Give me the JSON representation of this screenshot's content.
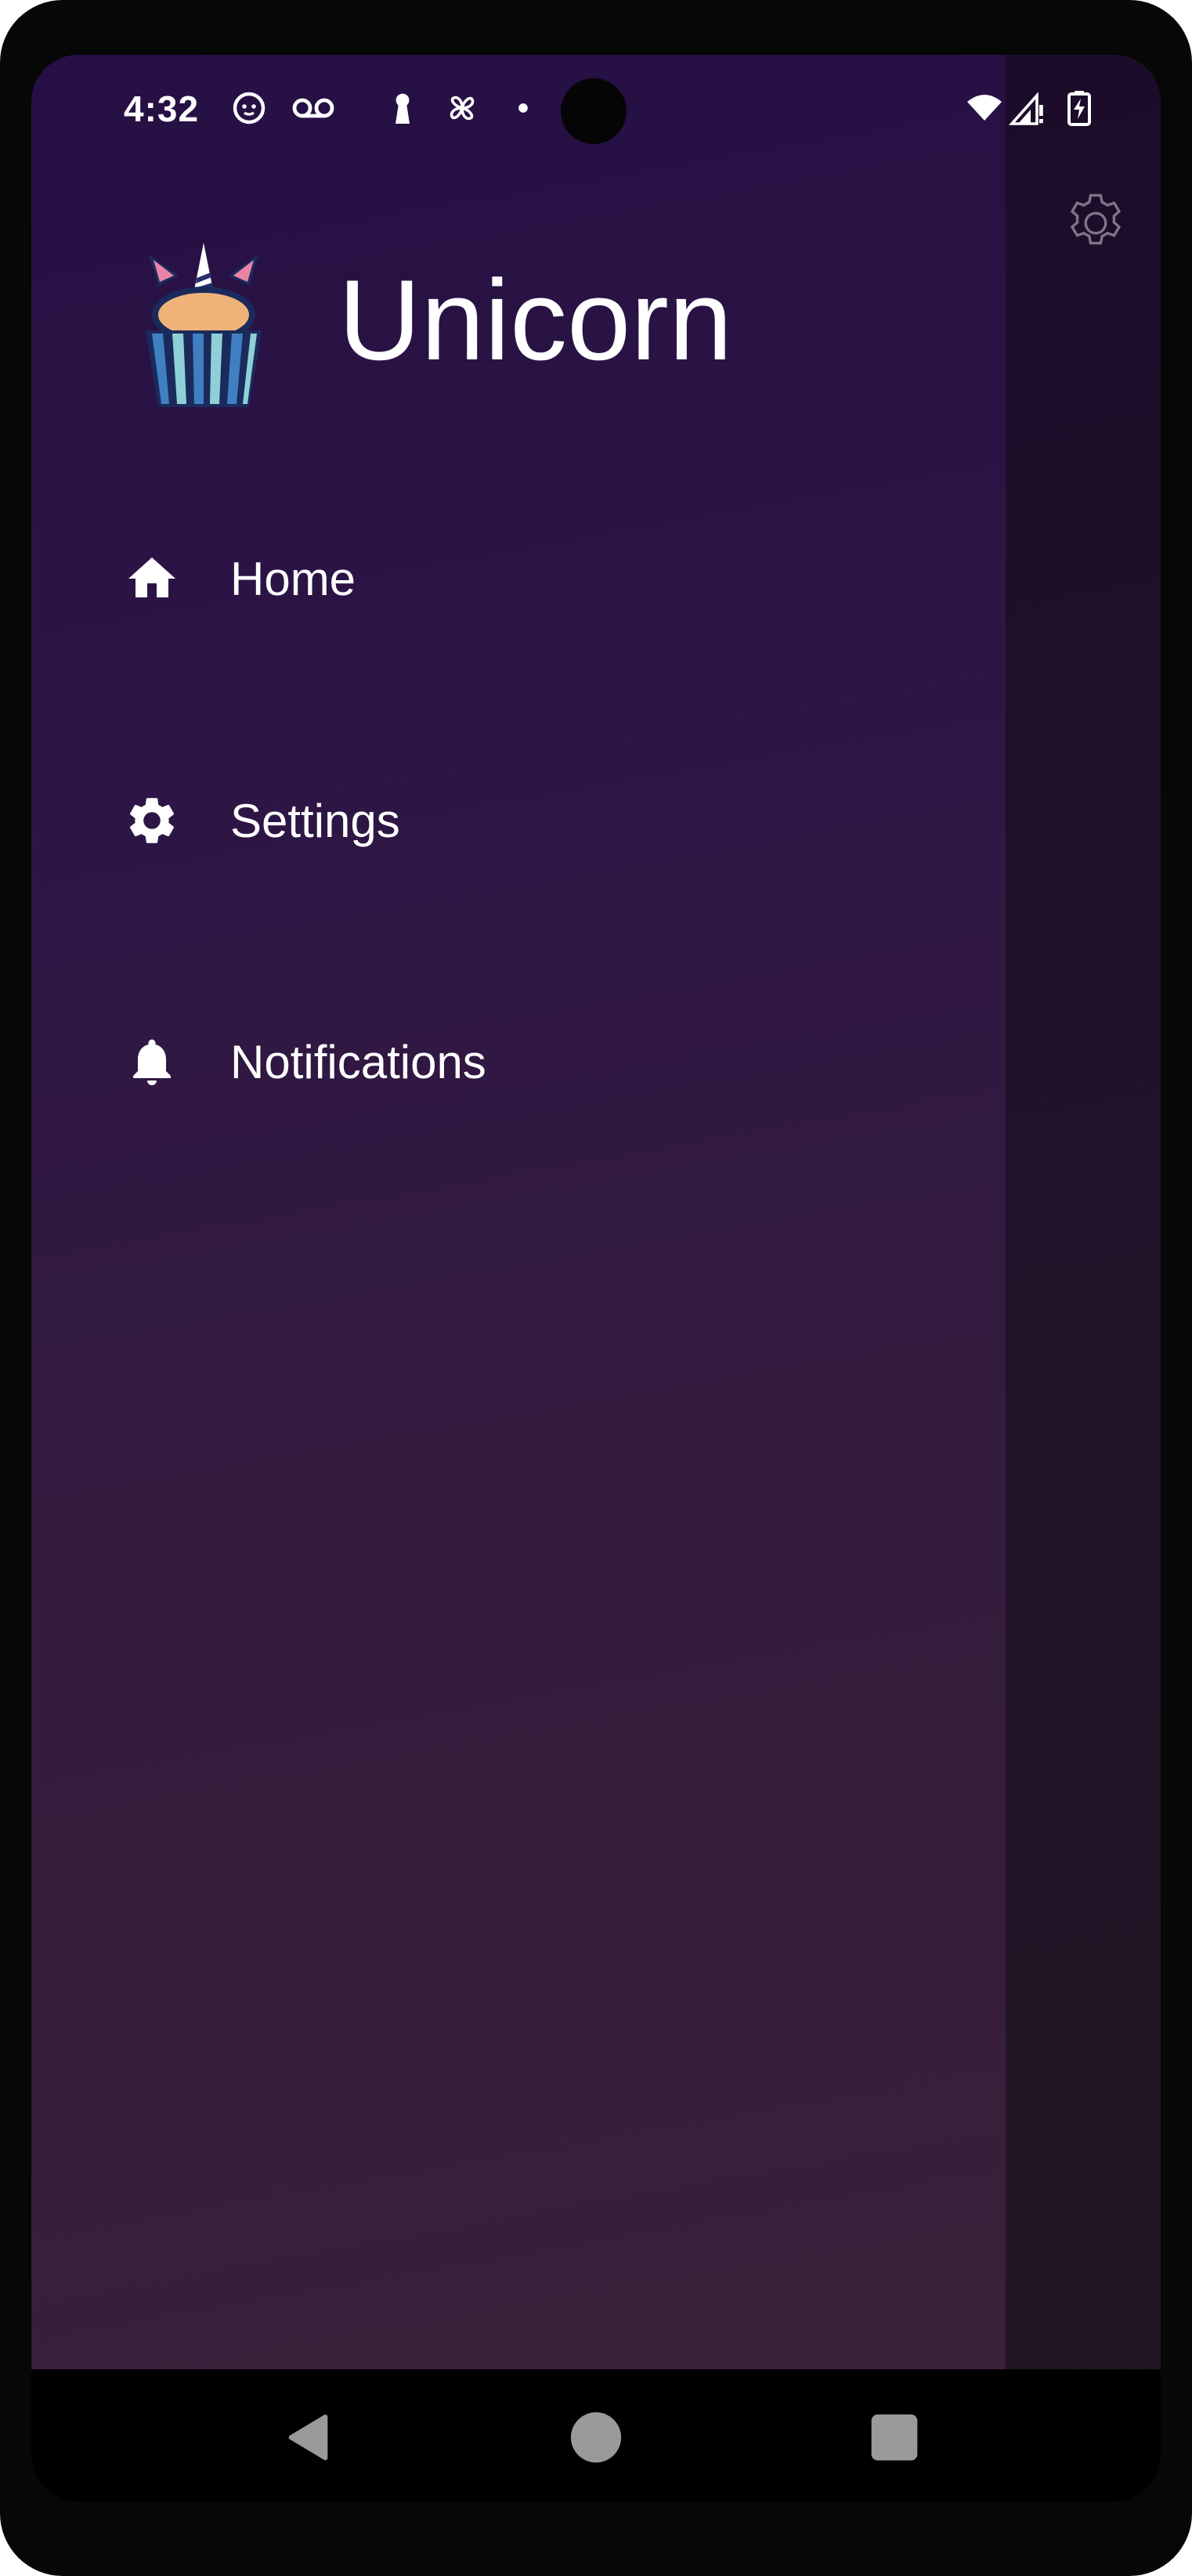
{
  "status_bar": {
    "time": "4:32",
    "left_icons": [
      "cat-face-icon",
      "voicemail-icon",
      "keyhole-icon",
      "pinwheel-icon",
      "dot-icon"
    ],
    "right_icons": [
      "wifi-icon",
      "cellular-no-signal-icon",
      "battery-charging-icon"
    ]
  },
  "drawer": {
    "app_name": "Unicorn",
    "logo": "unicorn-cupcake-logo",
    "items": [
      {
        "label": "Home",
        "icon": "home-icon"
      },
      {
        "label": "Settings",
        "icon": "gear-icon"
      },
      {
        "label": "Notifications",
        "icon": "bell-icon"
      }
    ]
  },
  "background": {
    "action_icon": "settings-gear-outline-icon"
  },
  "nav_bar": {
    "buttons": [
      "back-icon",
      "home-circle-icon",
      "recents-square-icon"
    ]
  },
  "colors": {
    "drawer_top": "#250f44",
    "drawer_bottom": "#3a2038",
    "text": "#ffffff"
  }
}
